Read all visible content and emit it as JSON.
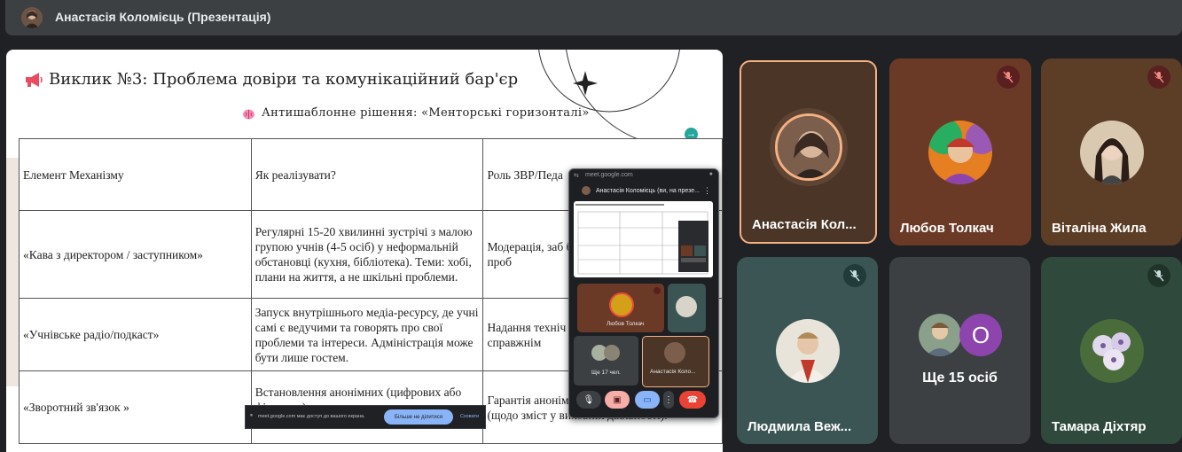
{
  "header": {
    "presenter_title": "Анастасія Коломієць (Презентація)"
  },
  "slide": {
    "heading_icon": "megaphone-icon",
    "heading": "Виклик №3: Проблема довіри та комунікаційний бар'єр",
    "sub_icon": "brain-icon",
    "subheading": "Антишаблонне рішення: «Менторські горизонталі»",
    "table": {
      "headers": [
        "Елемент Механізму",
        "Як реалізувати?",
        "Роль ЗВР/Педа"
      ],
      "rows": [
        [
          "«Кава з директором / заступником»",
          "Регулярні 15-20 хвилинні зустрічі з малою групою учнів (4-5 осіб) у неформальній обстановці (кухня, бібліотека). Теми: хобі, плани на життя, а не шкільні проблеми.",
          "Модерація, заб без оціночної атм про ідеї та проб"
        ],
        [
          "«Учнівське радіо/подкаст»",
          "Запуск внутрішнього медіа-ресурсу, де учні самі є ведучими та говорять про свої проблеми та інтереси. Адміністрація може бути лише гостем.",
          "Надання техніч контролю, щоб але справжнім"
        ],
        [
          "«Зворотний зв'язок »",
          "Встановлення анонімних (цифрових або фізичних) скриньок для критики та обговорюються на педагогічних радах.",
          "Гарантія анонім публічне реагу пропозиції (щодо зміст у виховній діяльності)."
        ]
      ]
    }
  },
  "mini_window": {
    "url": "meet.google.com",
    "presenter_name": "Анастасія Коломієць (ви, на презе...",
    "tiles": [
      {
        "name": "Любов Толкач"
      },
      {
        "name": "Анастасія Коло..."
      },
      {
        "name": "Ще 17 чел."
      }
    ]
  },
  "share_toast": {
    "text": "meet.google.com має доступ до вашого екрана.",
    "stop_label": "Більше не ділитися",
    "hide_label": "Сховати"
  },
  "participants": [
    {
      "name": "Анастасія Кол...",
      "muted": false,
      "active": true,
      "color": "#4a3526"
    },
    {
      "name": "Любов Толкач",
      "muted": true,
      "color": "#6b3a26"
    },
    {
      "name": "Віталіна Жила",
      "muted": true,
      "color": "#5c3d26"
    },
    {
      "name": "Людмила Веж...",
      "muted": true,
      "color": "#3b5554"
    },
    {
      "name": "Ще 15 осіб",
      "extra_initial": "О",
      "color": "#3c4043"
    },
    {
      "name": "Тамара Діхтяр",
      "muted": true,
      "color": "#2f4a3d"
    }
  ],
  "colors": {
    "active_border": "#f4b183",
    "muted_badge": "#5a2020",
    "purple_avatar": "#8e44ad"
  }
}
